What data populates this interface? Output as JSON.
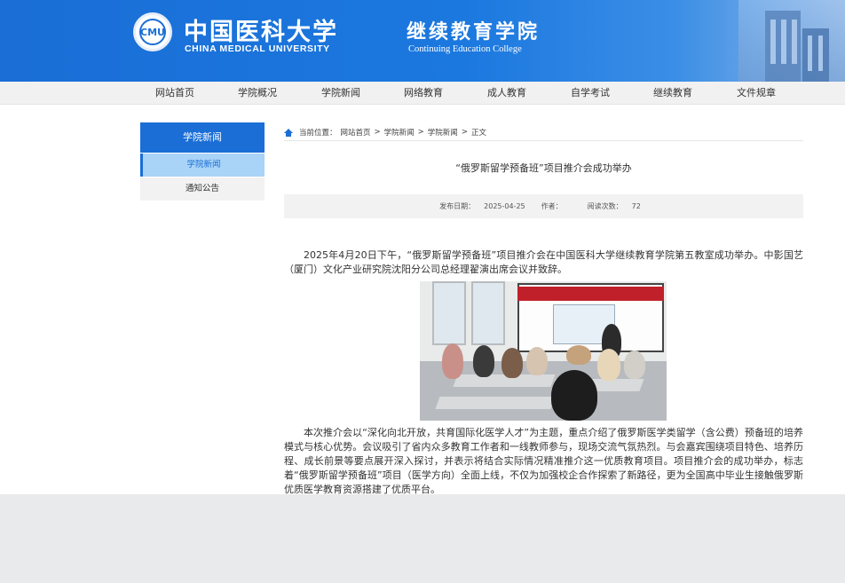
{
  "header": {
    "university_cn": "中国医科大学",
    "university_en": "CHINA MEDICAL UNIVERSITY",
    "college_cn": "继续教育学院",
    "college_en": "Continuing Education College",
    "logo_text": "中国医科大学"
  },
  "nav": {
    "items": [
      "网站首页",
      "学院概况",
      "学院新闻",
      "网络教育",
      "成人教育",
      "自学考试",
      "继续教育",
      "文件规章"
    ]
  },
  "sidebar": {
    "title": "学院新闻",
    "items": [
      {
        "label": "学院新闻",
        "active": true
      },
      {
        "label": "通知公告",
        "active": false
      }
    ]
  },
  "breadcrumb": {
    "prefix": "当前位置：",
    "items": [
      "网站首页",
      "学院新闻",
      "学院新闻",
      "正文"
    ],
    "separator": ">"
  },
  "article": {
    "title": "“俄罗斯留学预备班”项目推介会成功举办",
    "meta": {
      "date_label": "发布日期：",
      "date": "2025-04-25",
      "author_label": "作者：",
      "author": "",
      "views_label": "阅读次数：",
      "views": "72"
    },
    "paragraph1": "2025年4月20日下午，“俄罗斯留学预备班”项目推介会在中国医科大学继续教育学院第五教室成功举办。中影国艺（厦门）文化产业研究院沈阳分公司总经理翟演出席会议并致辞。",
    "photo_banner": "俄罗斯医学专家制（公费）培养预备班项目推介会",
    "paragraph2": "本次推介会以“深化向北开放，共育国际化医学人才”为主题，重点介绍了俄罗斯医学类留学（含公费）预备班的培养模式与核心优势。会议吸引了省内众多教育工作者和一线教师参与，现场交流气氛热烈。与会嘉宾围绕项目特色、培养历程、成长前景等要点展开深入探讨，并表示将结合实际情况精准推介这一优质教育项目。项目推介会的成功举办，标志着“俄罗斯留学预备班”项目（医学方向）全面上线，不仅为加强校企合作探索了新路径，更为全国高中毕业生接触俄罗斯优质医学教育资源搭建了优质平台。"
  },
  "colors": {
    "brand_blue": "#1a6ed6",
    "sidebar_active": "#a9d3f7",
    "nav_bg": "#f1f1f1",
    "footer_bg": "#e9eaec"
  }
}
